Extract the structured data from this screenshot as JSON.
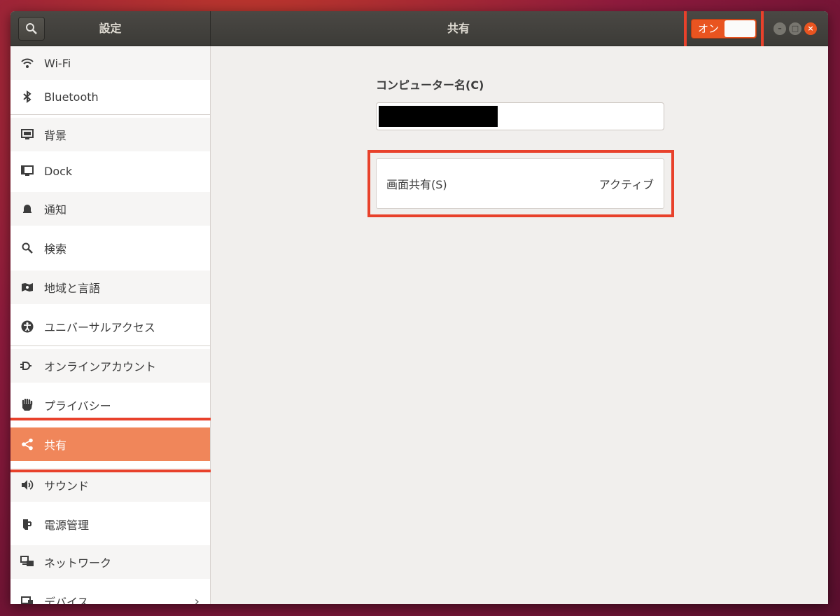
{
  "header": {
    "sidebar_title": "設定",
    "page_title": "共有",
    "sharing_switch": {
      "label": "オン",
      "state": "on"
    },
    "window_controls": {
      "minimize": "–",
      "maximize": "□",
      "close": "×"
    }
  },
  "sidebar": {
    "items": [
      {
        "label": "Wi-Fi",
        "icon": "wifi-icon"
      },
      {
        "label": "Bluetooth",
        "icon": "bluetooth-icon"
      },
      {
        "label": "背景",
        "icon": "background-icon"
      },
      {
        "label": "Dock",
        "icon": "dock-icon"
      },
      {
        "label": "通知",
        "icon": "bell-icon"
      },
      {
        "label": "検索",
        "icon": "search-icon"
      },
      {
        "label": "地域と言語",
        "icon": "region-icon"
      },
      {
        "label": "ユニバーサルアクセス",
        "icon": "accessibility-icon"
      },
      {
        "label": "オンラインアカウント",
        "icon": "online-accounts-icon"
      },
      {
        "label": "プライバシー",
        "icon": "hand-icon"
      },
      {
        "label": "共有",
        "icon": "share-icon",
        "active": true
      },
      {
        "label": "サウンド",
        "icon": "speaker-icon"
      },
      {
        "label": "電源管理",
        "icon": "power-icon"
      },
      {
        "label": "ネットワーク",
        "icon": "network-icon"
      },
      {
        "label": "デバイス",
        "icon": "devices-icon"
      }
    ]
  },
  "main": {
    "computer_name_label": "コンピューター名(C)",
    "computer_name_value": "",
    "screen_sharing": {
      "label": "画面共有(S)",
      "status": "アクティブ"
    }
  },
  "colors": {
    "accent": "#e95420",
    "active_row": "#f0865a",
    "highlight": "#e8412b"
  }
}
